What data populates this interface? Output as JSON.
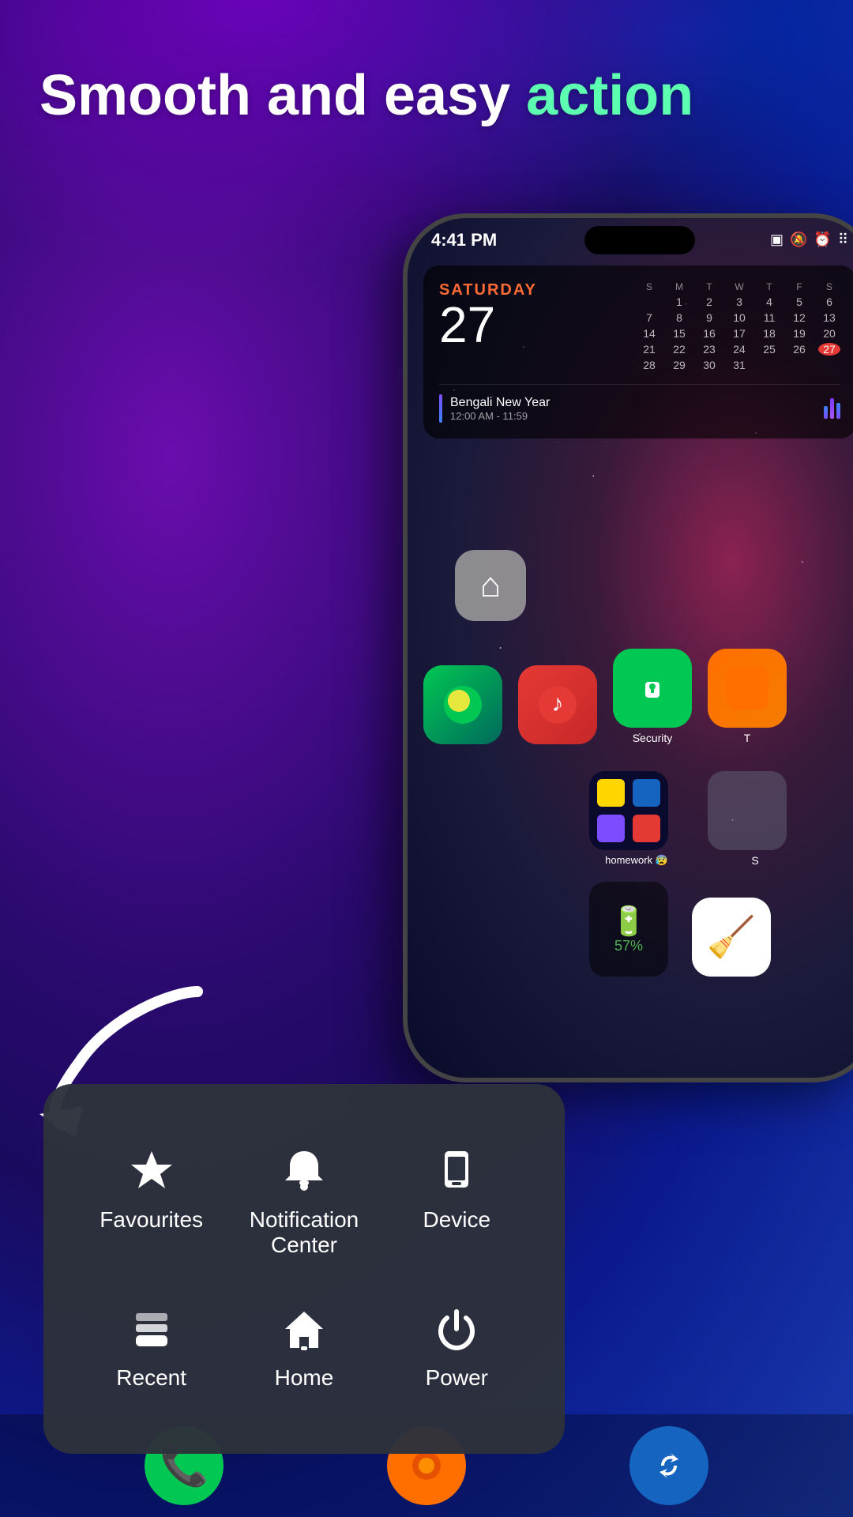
{
  "headline": {
    "line1": "Smooth and easy action",
    "green_words": "action"
  },
  "status_bar": {
    "time": "4:41 PM",
    "icons": [
      "messages",
      "mute",
      "alarm",
      "grid"
    ]
  },
  "calendar_widget": {
    "day_name": "SATURDAY",
    "day_number": "27",
    "event_name": "Bengali New Year",
    "event_time": "12:00 AM - 11:59",
    "cal_headers": [
      "S",
      "M",
      "T",
      "W",
      "T",
      "F",
      "S"
    ],
    "cal_rows": [
      [
        "",
        "",
        "",
        "",
        "",
        "1",
        "2",
        "3",
        "4",
        "5",
        "6"
      ],
      [
        "7",
        "8",
        "9",
        "10",
        "11",
        "12",
        "13"
      ],
      [
        "14",
        "15",
        "16",
        "17",
        "18",
        "19",
        "20"
      ],
      [
        "21",
        "22",
        "23",
        "24",
        "25",
        "26",
        "27"
      ],
      [
        "28",
        "29",
        "30",
        "31",
        "",
        "",
        ""
      ]
    ]
  },
  "context_menu": {
    "items": [
      {
        "id": "favourites",
        "label": "Favourites",
        "icon": "star"
      },
      {
        "id": "notification-center",
        "label": "Notification Center",
        "icon": "bell"
      },
      {
        "id": "device",
        "label": "Device",
        "icon": "device"
      },
      {
        "id": "recent",
        "label": "Recent",
        "icon": "stack"
      },
      {
        "id": "home",
        "label": "Home",
        "icon": "home"
      },
      {
        "id": "power",
        "label": "Power",
        "icon": "power"
      }
    ]
  },
  "app_icons": [
    {
      "id": "nature",
      "label": "",
      "color": "green"
    },
    {
      "id": "music",
      "label": "",
      "color": "red"
    },
    {
      "id": "security",
      "label": "Security",
      "color": "green-shield"
    },
    {
      "id": "unknown",
      "label": "T",
      "color": "orange"
    }
  ],
  "second_row_apps": [
    {
      "id": "homework",
      "label": "homework 😰",
      "color": "multi"
    },
    {
      "id": "s",
      "label": "S",
      "color": "gray"
    }
  ],
  "bottom_apps": [
    {
      "id": "phone",
      "color": "green",
      "icon": "📞"
    },
    {
      "id": "camera",
      "color": "orange",
      "icon": "🔴"
    },
    {
      "id": "sync",
      "color": "blue",
      "icon": "🔄"
    }
  ]
}
